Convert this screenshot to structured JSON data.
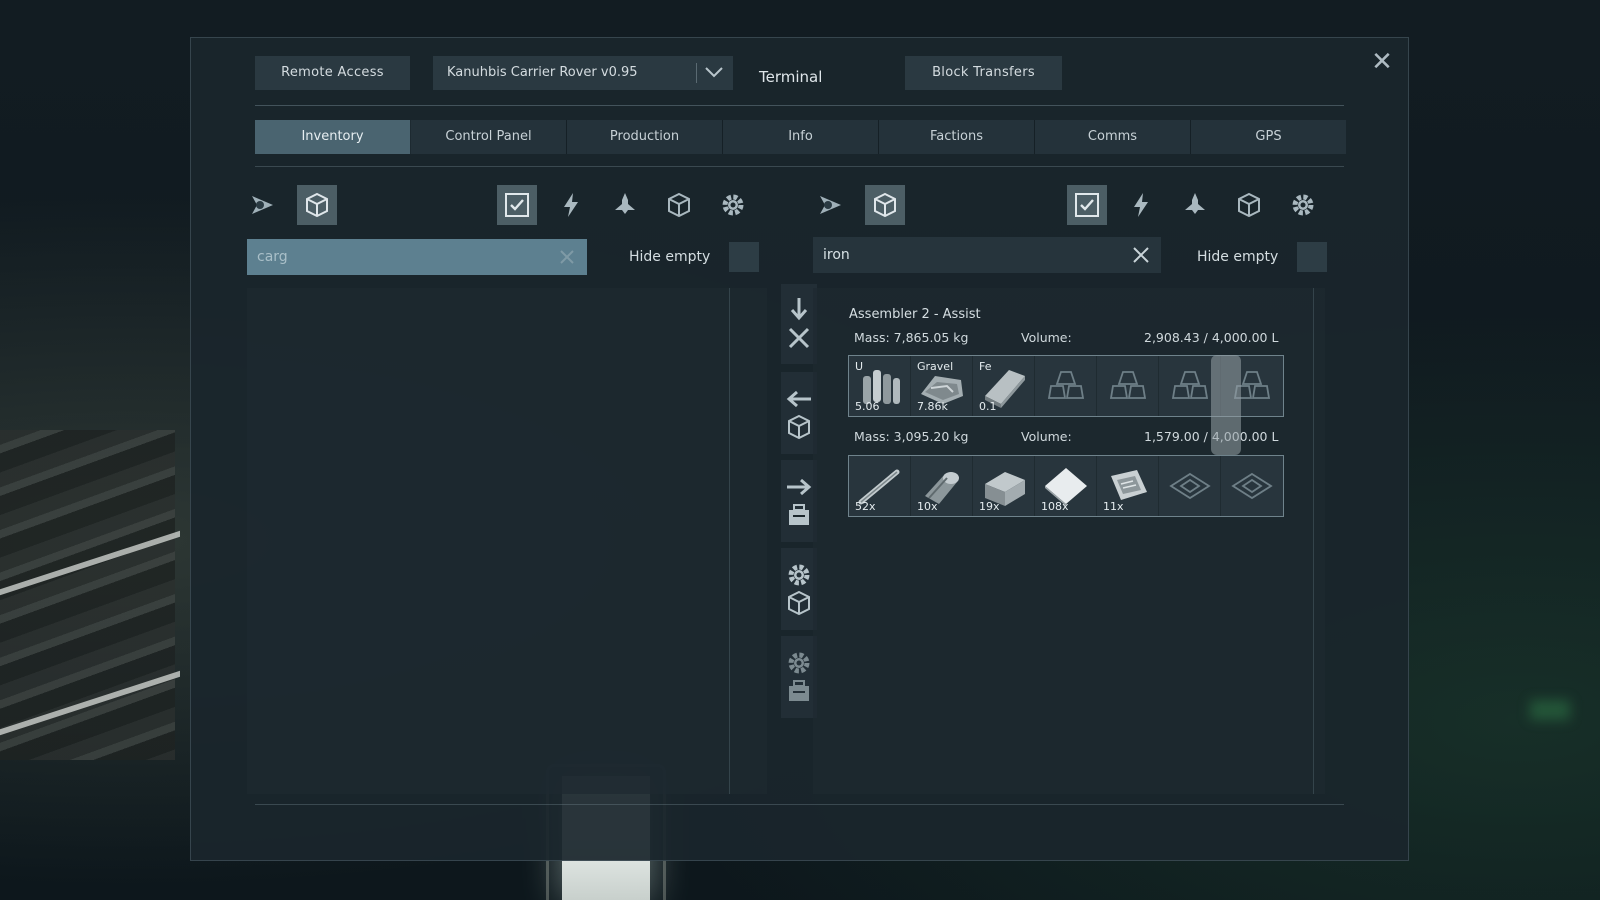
{
  "window": {
    "title": "Terminal",
    "close_glyph": "✕"
  },
  "top_bar": {
    "remote_access_label": "Remote Access",
    "grid_selector_value": "Kanuhbis Carrier Rover v0.95",
    "block_transfers_label": "Block Transfers"
  },
  "tabs": [
    {
      "label": "Inventory",
      "active": true
    },
    {
      "label": "Control Panel"
    },
    {
      "label": "Production"
    },
    {
      "label": "Info"
    },
    {
      "label": "Factions"
    },
    {
      "label": "Comms"
    },
    {
      "label": "GPS"
    }
  ],
  "left_panel": {
    "search_value": "carg",
    "hide_empty_label": "Hide empty"
  },
  "right_panel": {
    "search_value": "iron",
    "hide_empty_label": "Hide empty",
    "inventory": {
      "name": "Assembler 2 - Assist",
      "input": {
        "mass_label": "Mass: 7,865.05 kg",
        "volume_label": "Volume:",
        "volume_value": "2,908.43 / 4,000.00 L",
        "items": [
          {
            "tag": "U",
            "qty": "5.06",
            "icon": "uranium-ingot-icon"
          },
          {
            "tag": "Gravel",
            "qty": "7.86k",
            "icon": "gravel-icon"
          },
          {
            "tag": "Fe",
            "qty": "0.1",
            "icon": "iron-ingot-icon"
          },
          {
            "tag": "",
            "qty": "",
            "icon": "empty-ingot-slot-icon"
          },
          {
            "tag": "",
            "qty": "",
            "icon": "empty-ingot-slot-icon"
          },
          {
            "tag": "",
            "qty": "",
            "icon": "empty-ingot-slot-icon"
          },
          {
            "tag": "",
            "qty": "",
            "icon": "empty-ingot-slot-icon"
          }
        ]
      },
      "output": {
        "mass_label": "Mass: 3,095.20 kg",
        "volume_label": "Volume:",
        "volume_value": "1,579.00 / 4,000.00 L",
        "items": [
          {
            "qty": "52x",
            "icon": "small-tube-icon"
          },
          {
            "qty": "10x",
            "icon": "motor-icon"
          },
          {
            "qty": "19x",
            "icon": "construction-component-icon"
          },
          {
            "qty": "108x",
            "icon": "steel-plate-icon"
          },
          {
            "qty": "11x",
            "icon": "computer-icon"
          },
          {
            "qty": "",
            "icon": "empty-component-slot-icon"
          },
          {
            "qty": "",
            "icon": "empty-component-slot-icon"
          }
        ]
      }
    }
  },
  "colors": {
    "active_tab": "#4a6470",
    "focused_search": "#5d8090",
    "panel_bg": "#1a262c"
  }
}
